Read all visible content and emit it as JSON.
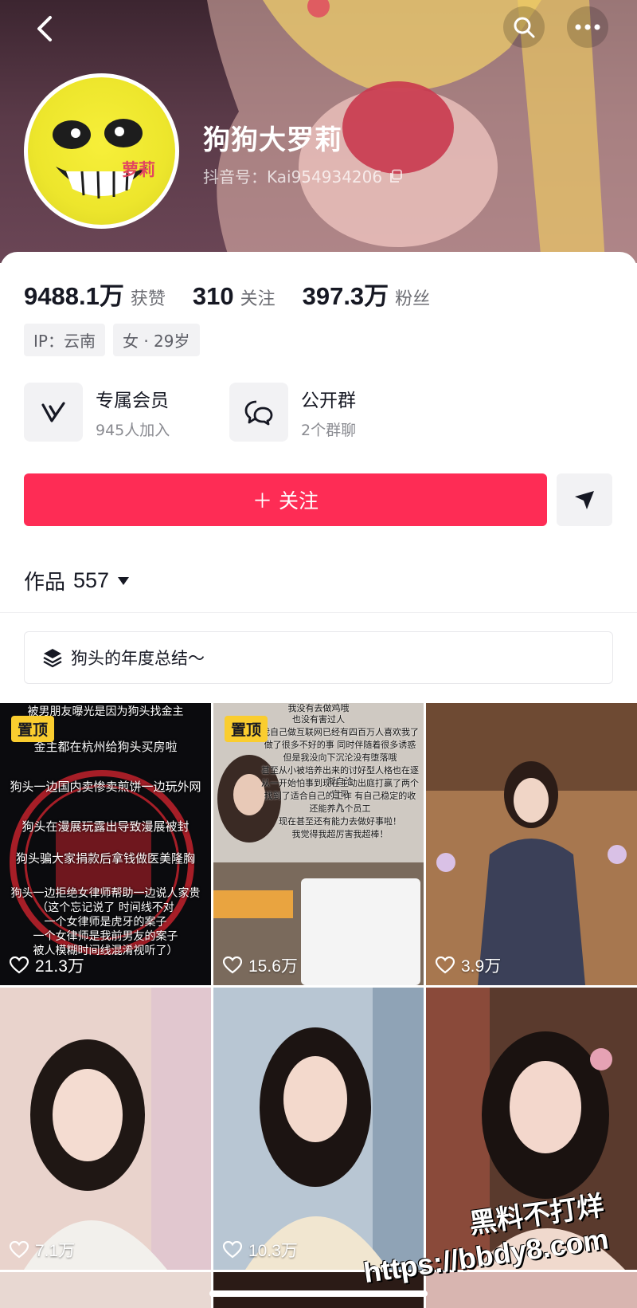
{
  "header": {
    "back_icon": "chevron-left-icon",
    "search_icon": "search-icon",
    "more_icon": "more-dots-icon"
  },
  "profile": {
    "avatar_text": "萝莉",
    "nickname": "狗狗大罗莉",
    "douyin_id": "抖音号：Kai954934206"
  },
  "stats": [
    {
      "num": "9488.1万",
      "label": "获赞"
    },
    {
      "num": "310",
      "label": "关注"
    },
    {
      "num": "397.3万",
      "label": "粉丝"
    }
  ],
  "tags": [
    "IP：云南",
    "女 · 29岁"
  ],
  "features": [
    {
      "title": "专属会员",
      "sub": "945人加入",
      "icon": "member-v-icon"
    },
    {
      "title": "公开群",
      "sub": "2个群聊",
      "icon": "group-chat-icon"
    }
  ],
  "follow_button": "＋ 关注",
  "works": {
    "label": "作品",
    "count": "557"
  },
  "collection": {
    "label": "狗头的年度总结～",
    "icon": "layers-icon"
  },
  "videos": [
    {
      "likes": "21.3万",
      "pinned": "置顶",
      "lines": [
        "被男朋友曝光是因为狗头找金主",
        "金主都在杭州给狗头买房啦",
        "狗头一边国内卖惨卖煎饼一边玩外网",
        "狗头在漫展玩露出导致漫展被封",
        "狗头骗大家捐款后拿钱做医美隆胸",
        "狗头一边拒绝女律师帮助一边说人家贵",
        "（这个忘记说了 时间线不对",
        "一个女律师是虎牙的案子",
        "一个女律师是我前男友的案子",
        "被人模糊时间线混淆视听了）"
      ]
    },
    {
      "likes": "15.6万",
      "pinned": "置顶",
      "lines": [
        "我没有去做鸡哦",
        "也没有害过人",
        "我自己做互联网已经有四百万人喜欢我了",
        "做了很多不好的事 同时伴随着很多诱惑",
        "但是我没向下沉沦没有堕落哦",
        "甚至从小被培养出来的讨好型人格也在逐渐自洽",
        "从一开始怕事到现在主动出庭打赢了两个官司",
        "找到了适合自己的工作 有自己稳定的收入",
        "还能养几个员工",
        "现在甚至还有能力去做好事啦！",
        "我觉得我超厉害我超棒！"
      ]
    },
    {
      "likes": "3.9万"
    },
    {
      "likes": "7.1万"
    },
    {
      "likes": "10.3万"
    },
    {
      "likes": ""
    }
  ],
  "watermark": {
    "line1": "黑料不打烊",
    "line2": "https://bbdy8.com"
  },
  "colors": {
    "accent": "#fe2c55",
    "pin_badge": "#facd2f"
  }
}
